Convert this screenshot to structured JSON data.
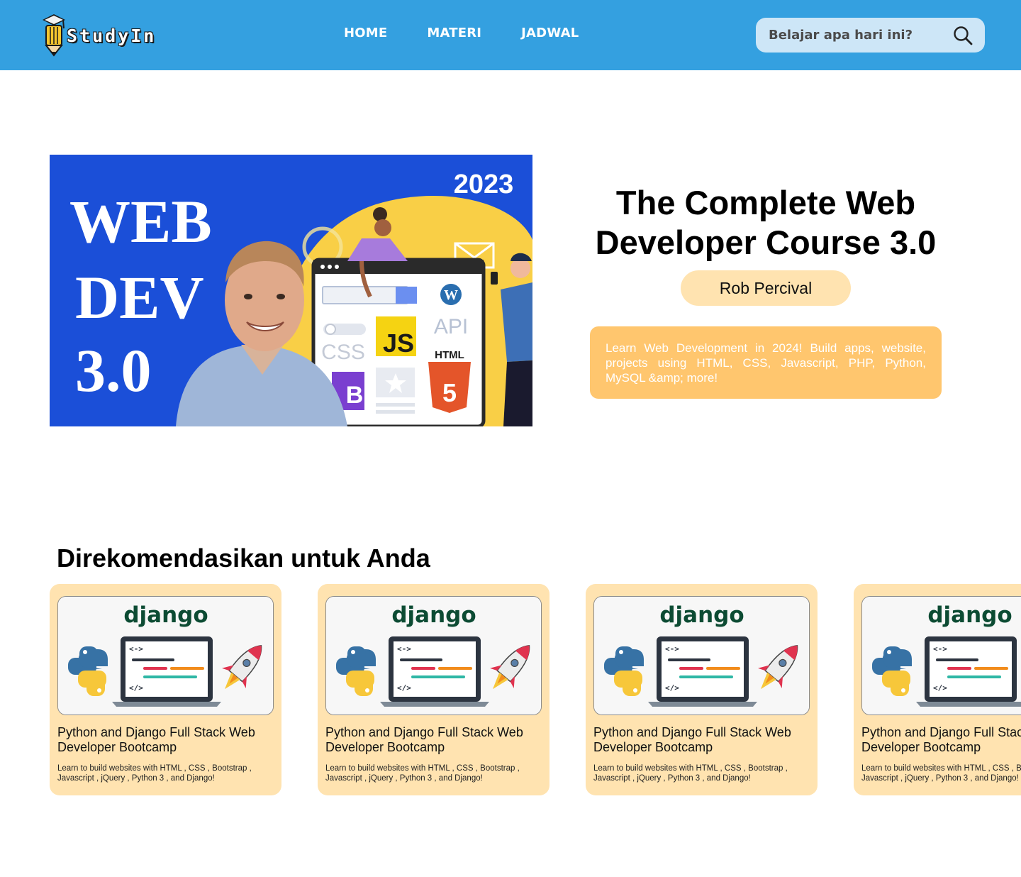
{
  "header": {
    "brand": "StudyIn",
    "nav": [
      {
        "label": "HOME"
      },
      {
        "label": "MATERI"
      },
      {
        "label": "JADWAL"
      }
    ],
    "search": {
      "placeholder": "Belajar apa hari ini?"
    }
  },
  "hero": {
    "image": {
      "year": "2023",
      "headline_lines": [
        "WEB",
        "DEV",
        "3.0"
      ],
      "labels": [
        "API",
        "CSS",
        "JS",
        "HTML",
        "5",
        "B"
      ]
    },
    "title": "The Complete Web Developer Course 3.0",
    "author": "Rob Percival",
    "description": "Learn Web Development in 2024! Build apps, website, projects using HTML, CSS, Javascript, PHP, Python, MySQL &amp; more!"
  },
  "recommendations": {
    "heading": "Direkomendasikan untuk Anda",
    "cards": [
      {
        "thumb_label": "django",
        "title_lines": [
          "Python and Django Full Stack Web",
          "Developer Bootcamp"
        ],
        "desc_lines": [
          "Learn to build websites with HTML , CSS , Bootstrap ,",
          "Javascript , jQuery , Python 3 , and Django!"
        ]
      },
      {
        "thumb_label": "django",
        "title_lines": [
          "Python and Django Full Stack Web",
          "Developer Bootcamp"
        ],
        "desc_lines": [
          "Learn to build websites with HTML , CSS , Bootstrap ,",
          "Javascript , jQuery , Python 3 , and Django!"
        ]
      },
      {
        "thumb_label": "django",
        "title_lines": [
          "Python and Django Full Stack Web",
          "Developer Bootcamp"
        ],
        "desc_lines": [
          "Learn to build websites with HTML , CSS , Bootstrap ,",
          "Javascript , jQuery , Python 3 , and Django!"
        ]
      },
      {
        "thumb_label": "django",
        "title_lines": [
          "Python and Django Full Stack Web",
          "Developer Bootcamp"
        ],
        "desc_lines": [
          "Learn to build websites with HTML , CSS , Bootstrap ,",
          "Javascript , jQuery , Python 3 , and Django!"
        ]
      }
    ]
  },
  "colors": {
    "header_bg": "#34a0e0",
    "search_bg": "#cde6f7",
    "card_bg": "#ffe3b0",
    "author_badge_bg": "#ffe3b0",
    "description_bg": "#ffc66e",
    "hero_image_bg": "#1b4fd8",
    "hero_image_accent": "#f9cf46",
    "django_green": "#0c4b33"
  },
  "icons": {
    "logo": "graduation-cap-pencil-icon",
    "search": "search-icon",
    "python": "python-logo-icon",
    "rocket": "rocket-icon",
    "laptop": "laptop-code-icon"
  }
}
